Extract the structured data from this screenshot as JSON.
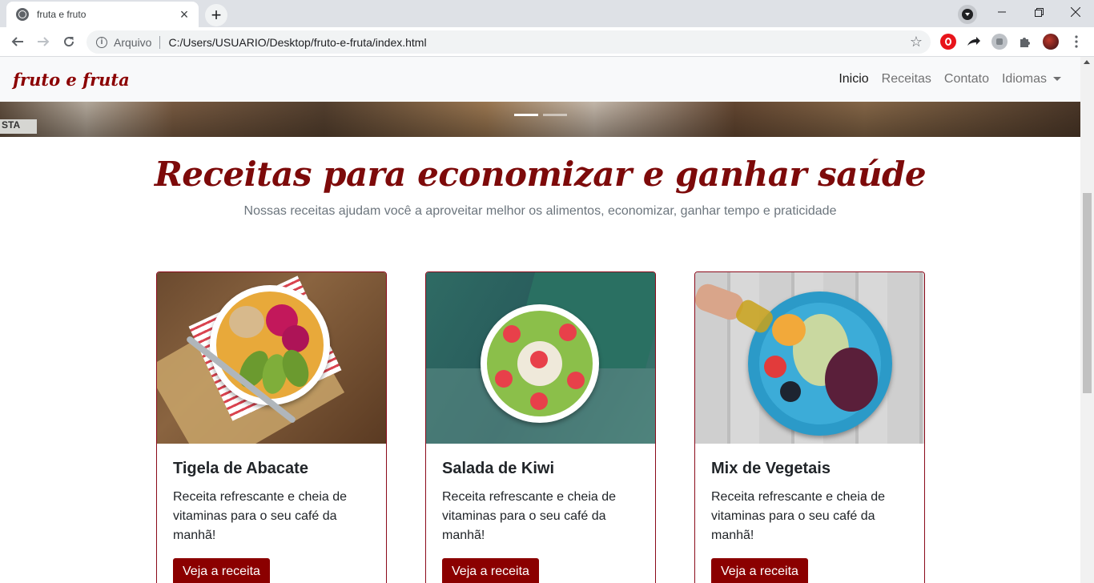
{
  "browser": {
    "tab_title": "fruta e fruto",
    "url_scheme": "Arquivo",
    "url": "C:/Users/USUARIO/Desktop/fruto-e-fruta/index.html"
  },
  "navbar": {
    "brand": "fruto e fruta",
    "links": [
      {
        "label": "Inicio"
      },
      {
        "label": "Receitas"
      },
      {
        "label": "Contato"
      },
      {
        "label": "Idiomas"
      }
    ]
  },
  "carousel": {
    "sign_text": "STA",
    "slides": 2,
    "active_slide": 1
  },
  "section": {
    "title": "Receitas para economizar e ganhar saúde",
    "subtitle": "Nossas receitas ajudam você a aproveitar melhor os alimentos, economizar, ganhar tempo e praticidade"
  },
  "cards": [
    {
      "title": "Tigela de Abacate",
      "text": "Receita refrescante e cheia de vitaminas para o seu café da manhã!",
      "button": "Veja a receita"
    },
    {
      "title": "Salada de Kiwi",
      "text": "Receita refrescante e cheia de vitaminas para o seu café da manhã!",
      "button": "Veja a receita"
    },
    {
      "title": "Mix de Vegetais",
      "text": "Receita refrescante e cheia de vitaminas para o seu café da manhã!",
      "button": "Veja a receita"
    }
  ],
  "colors": {
    "brand": "#8b0000",
    "heading": "#7d0a0a",
    "card_border": "#8b0a1a"
  }
}
